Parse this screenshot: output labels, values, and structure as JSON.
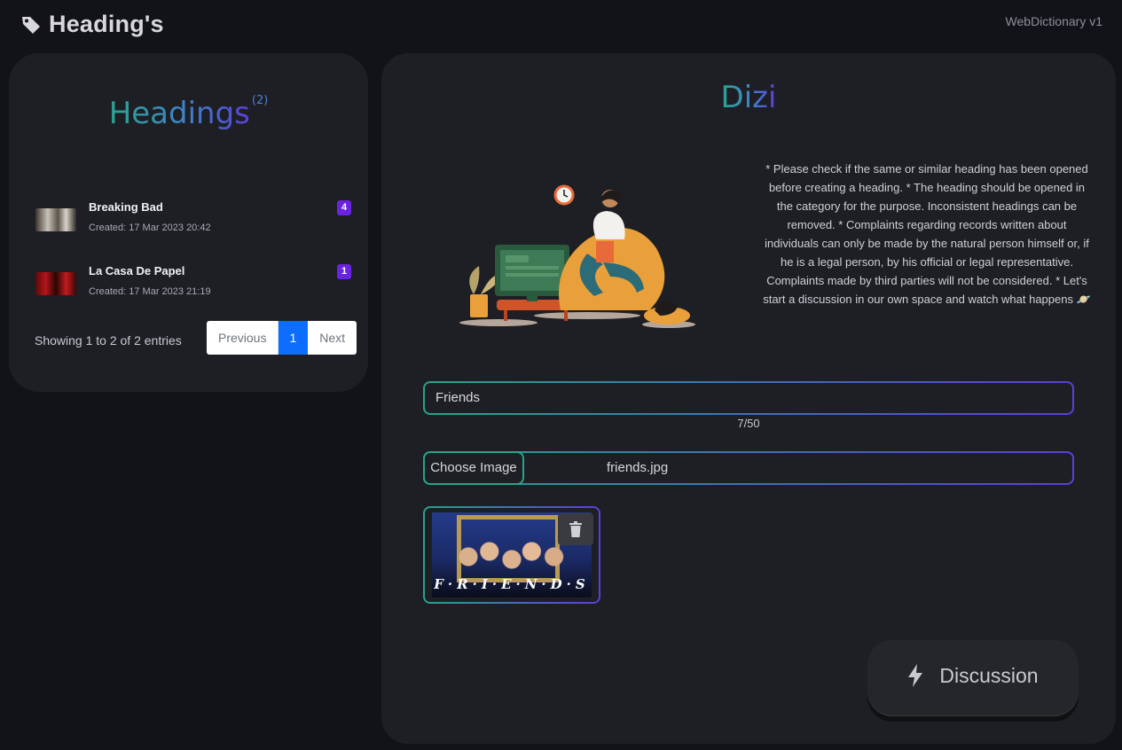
{
  "header": {
    "title": "Heading's",
    "version": "WebDictionary v1",
    "icon": "tag-icon"
  },
  "sidebar": {
    "heading": "Headings",
    "count": "(2)",
    "entries": [
      {
        "name": "Breaking Bad",
        "created": "Created: 17 Mar 2023 20:42",
        "badge": "4"
      },
      {
        "name": "La Casa De Papel",
        "created": "Created: 17 Mar 2023 21:19",
        "badge": "1"
      }
    ],
    "showing": "Showing 1 to 2 of 2 entries",
    "pagination": {
      "previous": "Previous",
      "current": "1",
      "next": "Next"
    }
  },
  "main": {
    "category": "Dizi",
    "notice": "* Please check if the same or similar heading has been opened before creating a heading. * The heading should be opened in the category for the purpose. Inconsistent headings can be removed. * Complaints regarding records written about individuals can only be made by the natural person himself or, if he is a legal person, by his official or legal representative. Complaints made by third parties will not be considered. * Let's start a discussion in our own space and watch what happens 🪐",
    "title_input_value": "Friends",
    "char_count": "7/50",
    "choose_image_label": "Choose Image",
    "file_name": "friends.jpg",
    "preview_logo": "F·R·I·E·N·D·S",
    "discussion_label": "Discussion"
  },
  "colors": {
    "accent_teal": "#27a38b",
    "accent_purple": "#5a3fd8",
    "badge": "#6a23e0",
    "pager_active": "#0d6efd"
  }
}
